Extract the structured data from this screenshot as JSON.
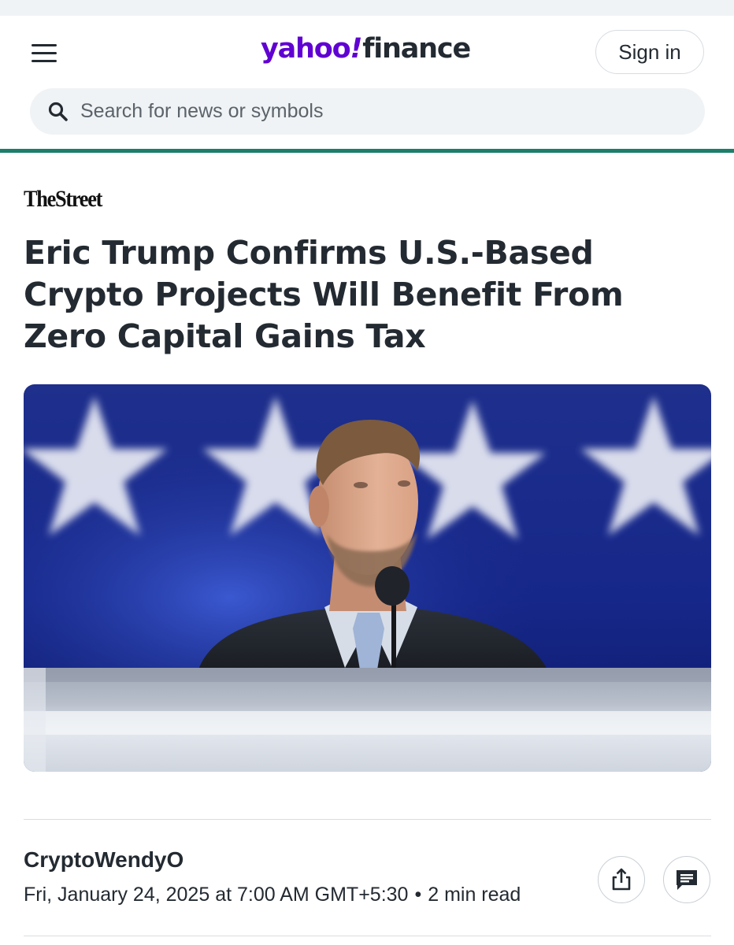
{
  "header": {
    "logo_yahoo": "yahoo",
    "logo_bang": "!",
    "logo_finance": "finance",
    "signin_label": "Sign in",
    "search_placeholder": "Search for news or symbols"
  },
  "article": {
    "publisher": "TheStreet",
    "headline": "Eric Trump Confirms U.S.-Based Crypto Projects Will Benefit From Zero Capital Gains Tax",
    "author": "CryptoWendyO",
    "date": "Fri, January 24, 2025 at 7:00 AM GMT+5:30",
    "separator": "•",
    "read_time": "2 min read"
  },
  "icons": {
    "menu": "hamburger-menu-icon",
    "search": "search-icon",
    "share": "share-icon",
    "comments": "comment-icon"
  },
  "colors": {
    "brand_purple": "#6001d2",
    "text": "#232a31",
    "accent_green": "#1b7f6a"
  }
}
